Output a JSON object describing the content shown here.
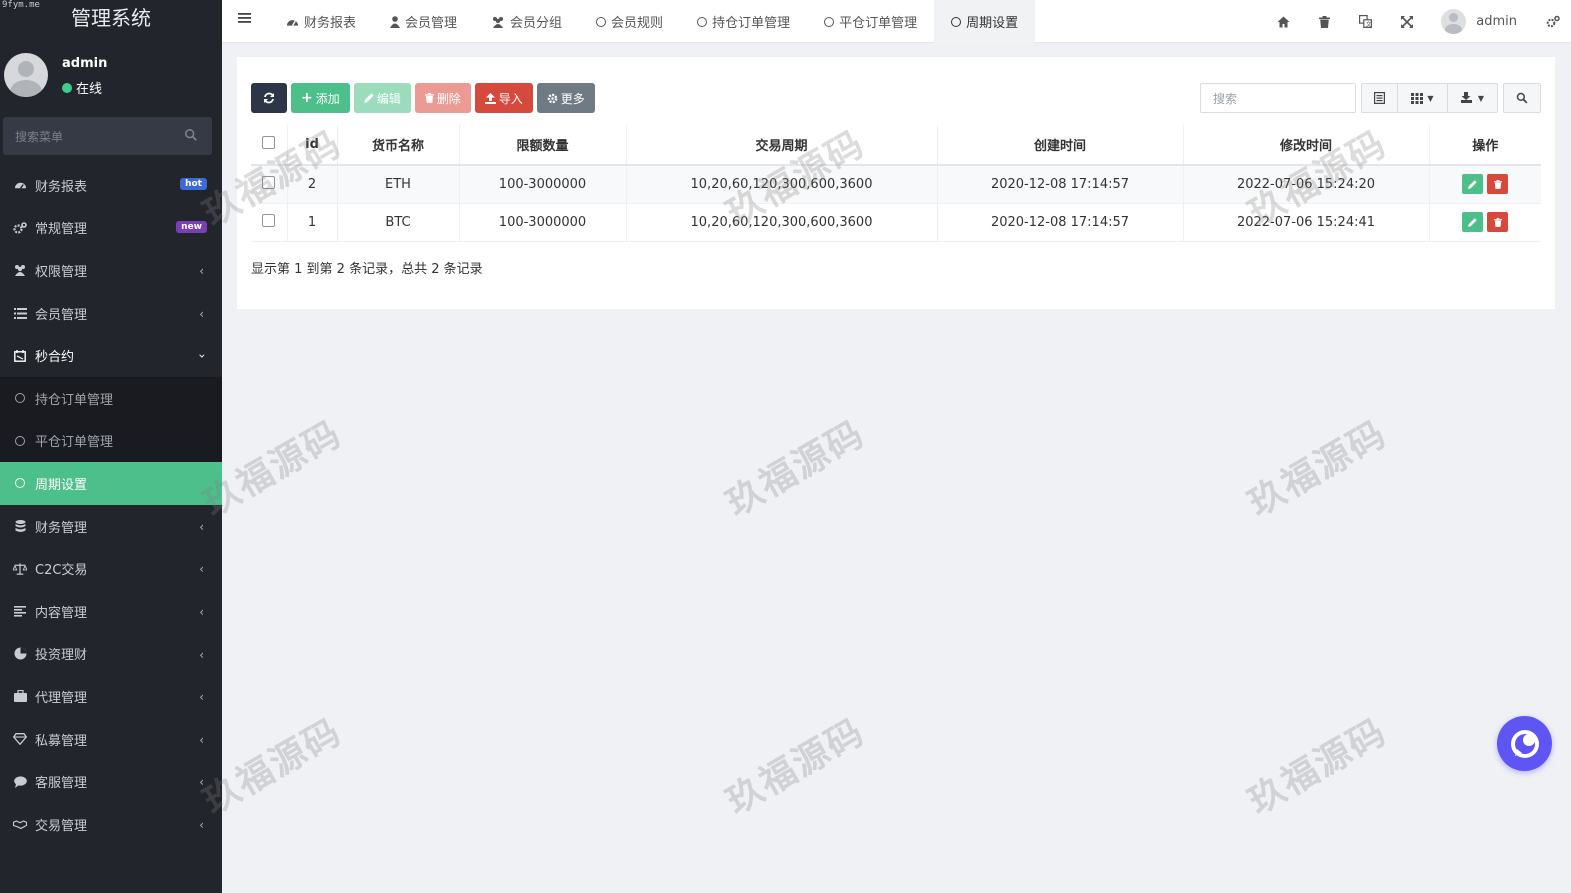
{
  "app": {
    "watermark_url": "9fym.me",
    "title": "管理系统"
  },
  "user": {
    "name": "admin",
    "status": "在线"
  },
  "sidebar": {
    "search_placeholder": "搜索菜单",
    "items": [
      {
        "label": "财务报表",
        "icon": "dashboard-icon",
        "badge": "hot"
      },
      {
        "label": "常规管理",
        "icon": "cogs-icon",
        "badge": "new"
      },
      {
        "label": "权限管理",
        "icon": "users-icon"
      },
      {
        "label": "会员管理",
        "icon": "list-icon"
      },
      {
        "label": "秒合约",
        "icon": "calendar-icon",
        "open": true
      },
      {
        "label": "持仓订单管理",
        "icon": "circle-icon",
        "sub": true
      },
      {
        "label": "平仓订单管理",
        "icon": "circle-icon",
        "sub": true
      },
      {
        "label": "周期设置",
        "icon": "circle-icon",
        "active": true
      },
      {
        "label": "财务管理",
        "icon": "database-icon"
      },
      {
        "label": "C2C交易",
        "icon": "balance-scale-icon"
      },
      {
        "label": "内容管理",
        "icon": "align-left-icon"
      },
      {
        "label": "投资理财",
        "icon": "pie-icon"
      },
      {
        "label": "代理管理",
        "icon": "briefcase-icon"
      },
      {
        "label": "私募管理",
        "icon": "diamond-icon"
      },
      {
        "label": "客服管理",
        "icon": "comment-icon"
      },
      {
        "label": "交易管理",
        "icon": "handshake-icon"
      }
    ]
  },
  "topbar": {
    "tabs": [
      {
        "label": "财务报表",
        "icon": "dashboard-icon"
      },
      {
        "label": "会员管理",
        "icon": "user-icon"
      },
      {
        "label": "会员分组",
        "icon": "users-icon"
      },
      {
        "label": "会员规则",
        "icon": "circle-icon"
      },
      {
        "label": "持仓订单管理",
        "icon": "circle-icon"
      },
      {
        "label": "平仓订单管理",
        "icon": "circle-icon"
      },
      {
        "label": "周期设置",
        "icon": "circle-icon",
        "active": true
      }
    ],
    "username": "admin"
  },
  "toolbar": {
    "add": "添加",
    "edit": "编辑",
    "delete": "删除",
    "import": "导入",
    "more": "更多",
    "search_placeholder": "搜索"
  },
  "table": {
    "columns": [
      "id",
      "货币名称",
      "限额数量",
      "交易周期",
      "创建时间",
      "修改时间",
      "操作"
    ],
    "rows": [
      {
        "id": "2",
        "currency": "ETH",
        "limit": "100-3000000",
        "periods": "10,20,60,120,300,600,3600",
        "created": "2020-12-08 17:14:57",
        "modified": "2022-07-06 15:24:20"
      },
      {
        "id": "1",
        "currency": "BTC",
        "limit": "100-3000000",
        "periods": "10,20,60,120,300,600,3600",
        "created": "2020-12-08 17:14:57",
        "modified": "2022-07-06 15:24:41"
      }
    ],
    "pager_info": "显示第 1 到第 2 条记录，总共 2 条记录"
  },
  "watermark_text": "玖福源码",
  "colors": {
    "sidebar_bg": "#22252c",
    "accent_green": "#4cbf8a",
    "danger_red": "#d64a3e",
    "chat_purple": "#5f55f5"
  }
}
